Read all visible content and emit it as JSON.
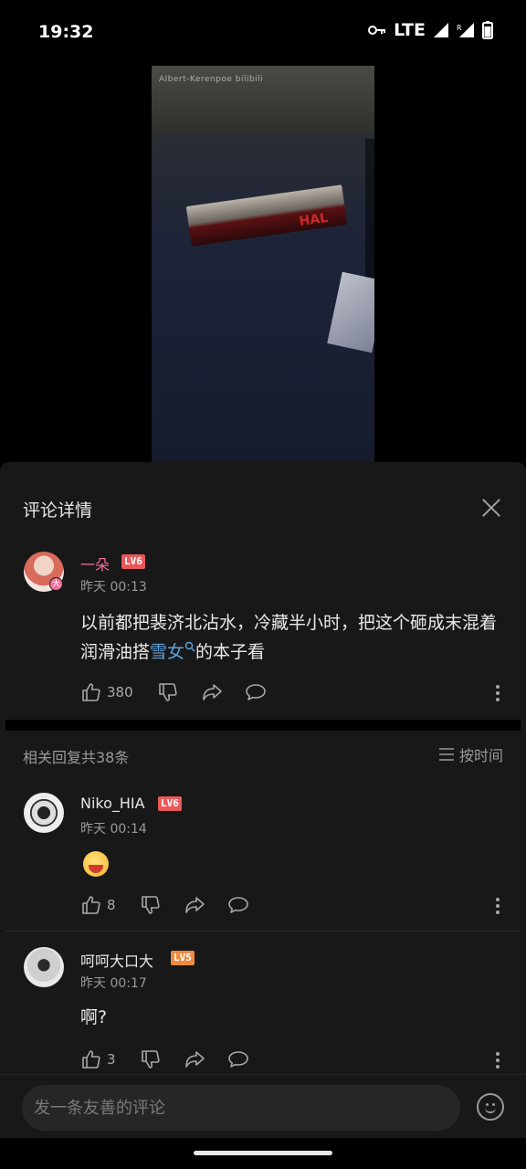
{
  "status_bar": {
    "time": "19:32",
    "network": "LTE",
    "icons": [
      "key-icon",
      "signal-icon",
      "roaming-signal-icon",
      "battery-icon"
    ]
  },
  "video": {
    "watermark": "Albert-Kerenpoe bilibili",
    "box_text": "HAL"
  },
  "panel": {
    "title": "评论详情",
    "close_icon": "close-icon"
  },
  "main_comment": {
    "username": "一朵",
    "username_color": "#f36e9a",
    "level": "LV6",
    "avatar_badge": "大",
    "time": "昨天 00:13",
    "text_before_link": "以前都把裴济北沾水，冷藏半小时，把这个砸成末混着润滑油搭",
    "link_text": "雪女",
    "text_after_link": "的本子看",
    "likes": "380"
  },
  "replies_header": {
    "count_text": "相关回复共38条",
    "sort_label": "按时间"
  },
  "replies": [
    {
      "username": "Niko_HIA",
      "level": "LV6",
      "time": "昨天 00:14",
      "content_type": "emoji",
      "emoji": "shocked-face-emoji",
      "likes": "8"
    },
    {
      "username": "呵呵大口大",
      "level": "LV5",
      "time": "昨天 00:17",
      "text": "啊?",
      "likes": "3"
    }
  ],
  "input": {
    "placeholder": "发一条友善的评论"
  },
  "colors": {
    "panel_bg": "#181818",
    "link": "#5fa3dc",
    "lv6": "#e85a5a",
    "lv5": "#f08a3e"
  }
}
